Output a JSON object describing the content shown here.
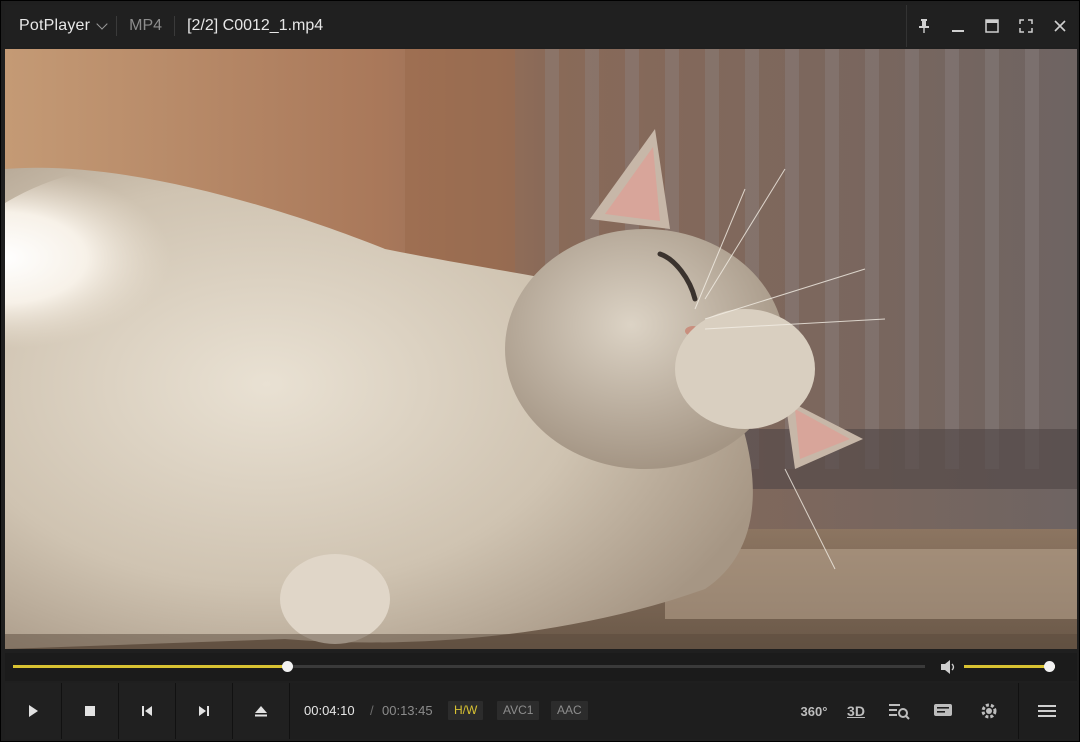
{
  "titlebar": {
    "app_name": "PotPlayer",
    "format": "MP4",
    "file_title": "[2/2] C0012_1.mp4"
  },
  "playback": {
    "current_time": "00:04:10",
    "separator": "/",
    "duration": "00:13:45",
    "progress_fraction": 0.3,
    "volume_fraction": 1.0
  },
  "badges": {
    "decoder": "H/W",
    "video_codec": "AVC1",
    "audio_codec": "AAC"
  },
  "right_controls": {
    "vr360_label": "360°",
    "threed_label": "3D"
  },
  "colors": {
    "accent": "#d8c232",
    "hw_badge": "#d8c232"
  },
  "icons": [
    "menu-caret-icon",
    "pin-icon",
    "minimize-icon",
    "maximize-icon",
    "fullscreen-icon",
    "close-icon",
    "play-icon",
    "stop-icon",
    "previous-icon",
    "next-icon",
    "eject-icon",
    "volume-icon",
    "playlist-search-icon",
    "chat-icon",
    "settings-icon",
    "menu-icon"
  ]
}
